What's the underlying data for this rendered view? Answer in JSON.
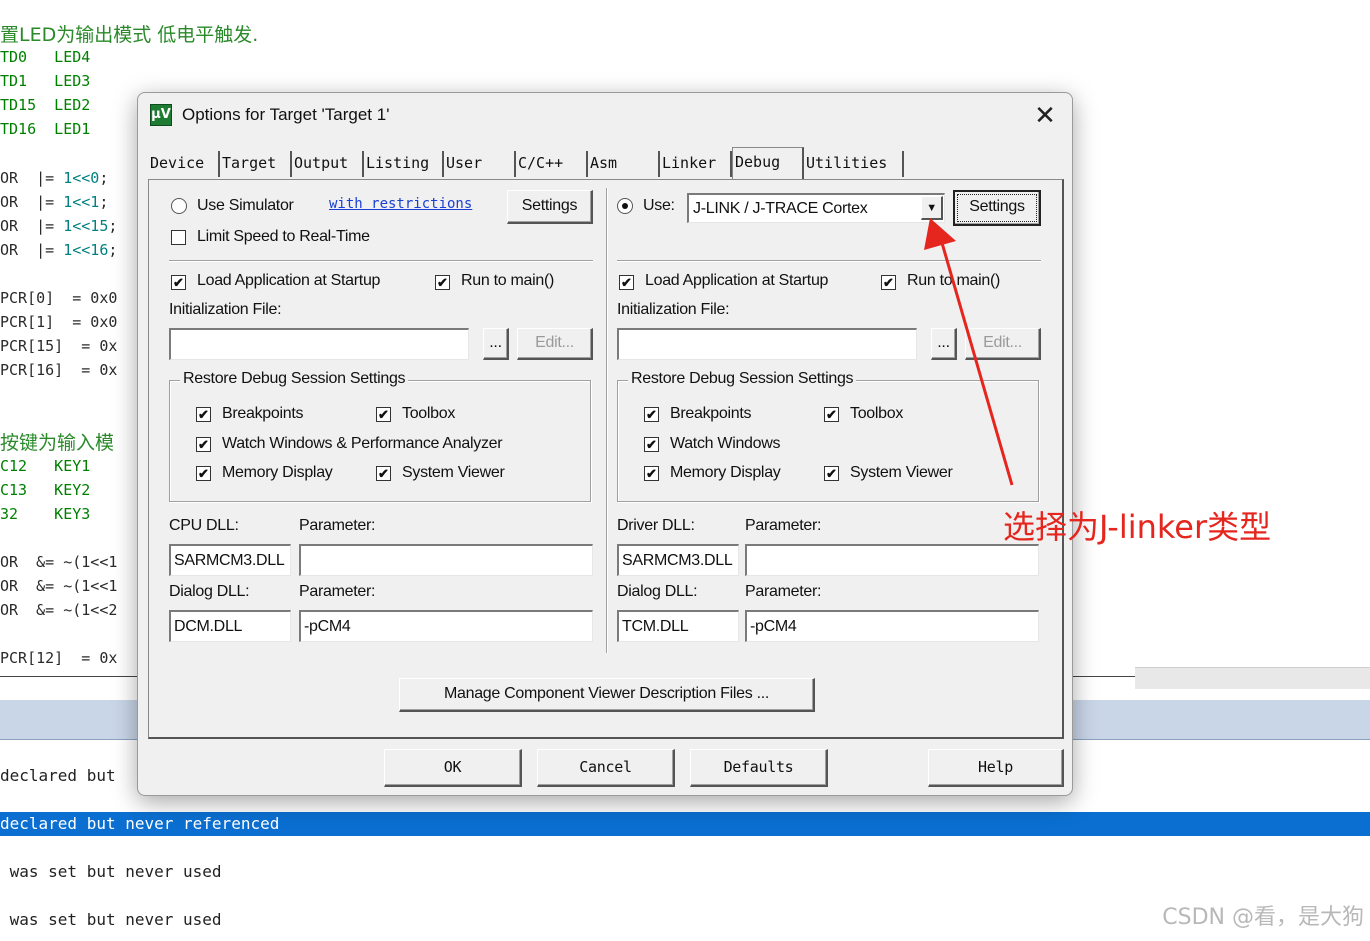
{
  "background_editor": {
    "comment_line": "置LED为输出模式 低电平触发.",
    "led_lines": [
      "TD0   LED4",
      "TD1   LED3",
      "TD15  LED2",
      "TD16  LED1"
    ],
    "or_lines": [
      {
        "pre": "OR  |= ",
        "num": "1<<0",
        "post": ";"
      },
      {
        "pre": "OR  |= ",
        "num": "1<<1",
        "post": ";"
      },
      {
        "pre": "OR  |= ",
        "num": "1<<15",
        "post": ";"
      },
      {
        "pre": "OR  |= ",
        "num": "1<<16",
        "post": ";"
      }
    ],
    "pcr_lines": [
      "PCR[0]  = 0x0",
      "PCR[1]  = 0x0",
      "PCR[15]  = 0x",
      "PCR[16]  = 0x"
    ],
    "key_comment": "按键为输入模",
    "key_lines": [
      "C12   KEY1",
      "C13   KEY2",
      "32    KEY3"
    ],
    "and_lines": [
      "OR  &= ~(1<<1",
      "OR  &= ~(1<<1",
      "OR  &= ~(1<<2"
    ],
    "last_line": "PCR[12]  = 0x"
  },
  "build_output": {
    "lines": [
      {
        "text": "declared but",
        "selected": false
      },
      {
        "text": "declared but never referenced",
        "selected": true
      },
      {
        "text": " was set but never used",
        "selected": false
      },
      {
        "text": " was set but never used",
        "selected": false
      }
    ]
  },
  "watermark": "CSDN @看，是大狗",
  "annotation": {
    "text": "选择为J-linker类型",
    "color": "#e5261f"
  },
  "dialog": {
    "title": "Options for Target 'Target 1'",
    "close_glyph": "✕",
    "icon_text": "μV",
    "tabs": [
      "Device",
      "Target",
      "Output",
      "Listing",
      "User",
      "C/C++",
      "Asm",
      "Linker",
      "Debug",
      "Utilities"
    ],
    "active_tab": "Debug",
    "left": {
      "use_simulator": "Use Simulator",
      "restrictions_link": "with restrictions",
      "settings": "Settings",
      "limit_speed": "Limit Speed to Real-Time",
      "load_app": "Load Application at Startup",
      "run_to_main": "Run to main()",
      "init_file_label": "Initialization File:",
      "init_file_value": "",
      "browse": "...",
      "edit": "Edit...",
      "restore_group": "Restore Debug Session Settings",
      "breakpoints": "Breakpoints",
      "toolbox": "Toolbox",
      "watch_windows": "Watch Windows & Performance Analyzer",
      "memory_display": "Memory Display",
      "system_viewer": "System Viewer",
      "cpu_dll_label": "CPU DLL:",
      "cpu_dll_value": "SARMCM3.DLL",
      "cpu_param_label": "Parameter:",
      "cpu_param_value": "",
      "dialog_dll_label": "Dialog DLL:",
      "dialog_dll_value": "DCM.DLL",
      "dialog_param_label": "Parameter:",
      "dialog_param_value": "-pCM4"
    },
    "right": {
      "use_label": "Use:",
      "driver": "J-LINK / J-TRACE Cortex",
      "settings": "Settings",
      "load_app": "Load Application at Startup",
      "run_to_main": "Run to main()",
      "init_file_label": "Initialization File:",
      "init_file_value": "",
      "browse": "...",
      "edit": "Edit...",
      "restore_group": "Restore Debug Session Settings",
      "breakpoints": "Breakpoints",
      "toolbox": "Toolbox",
      "watch_windows": "Watch Windows",
      "memory_display": "Memory Display",
      "system_viewer": "System Viewer",
      "driver_dll_label": "Driver DLL:",
      "driver_dll_value": "SARMCM3.DLL",
      "driver_param_label": "Parameter:",
      "driver_param_value": "",
      "dialog_dll_label": "Dialog DLL:",
      "dialog_dll_value": "TCM.DLL",
      "dialog_param_label": "Parameter:",
      "dialog_param_value": "-pCM4"
    },
    "manage_button": "Manage Component Viewer Description Files ...",
    "footer": {
      "ok": "OK",
      "cancel": "Cancel",
      "defaults": "Defaults",
      "help": "Help"
    },
    "check_glyph": "✔"
  }
}
